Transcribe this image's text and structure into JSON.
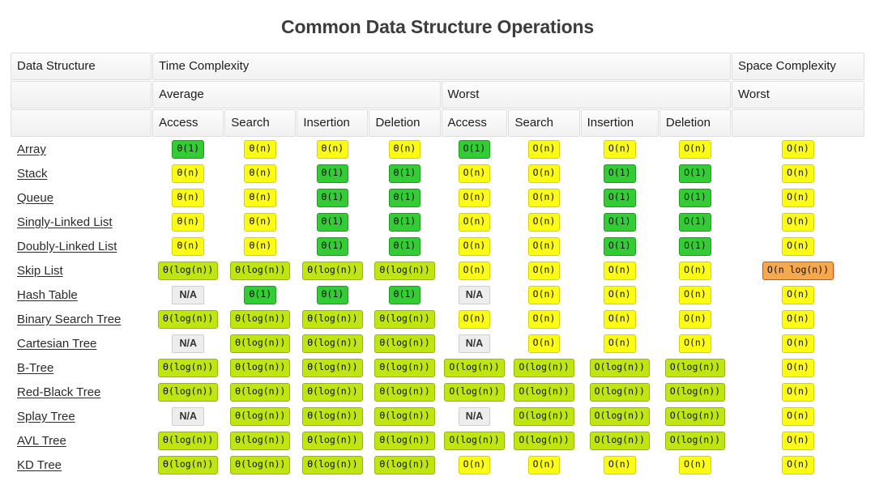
{
  "title": "Common Data Structure Operations",
  "header": {
    "row1": [
      {
        "label": "Data Structure",
        "span": 1
      },
      {
        "label": "Time Complexity",
        "span": 8
      },
      {
        "label": "Space Complexity",
        "span": 1
      }
    ],
    "row2": [
      {
        "label": "",
        "span": 1
      },
      {
        "label": "Average",
        "span": 4
      },
      {
        "label": "Worst",
        "span": 4
      },
      {
        "label": "Worst",
        "span": 1
      }
    ],
    "row3": [
      {
        "label": "",
        "span": 1
      },
      {
        "label": "Access",
        "span": 1
      },
      {
        "label": "Search",
        "span": 1
      },
      {
        "label": "Insertion",
        "span": 1
      },
      {
        "label": "Deletion",
        "span": 1
      },
      {
        "label": "Access",
        "span": 1
      },
      {
        "label": "Search",
        "span": 1
      },
      {
        "label": "Insertion",
        "span": 1
      },
      {
        "label": "Deletion",
        "span": 1
      },
      {
        "label": "",
        "span": 1
      }
    ]
  },
  "colors": {
    "green": "#34cc34",
    "yellow": "#fbfb15",
    "yellowgreen": "#bfe512",
    "orange": "#f5a84d",
    "na": "#ededed",
    "title": "#3c3c3c"
  },
  "chart_data": {
    "type": "table",
    "title": "Common Data Structure Operations",
    "columns": [
      "Data Structure",
      "Average Access",
      "Average Search",
      "Average Insertion",
      "Average Deletion",
      "Worst Access",
      "Worst Search",
      "Worst Insertion",
      "Worst Deletion",
      "Space Worst"
    ],
    "rows": [
      {
        "name": "Array",
        "cells": [
          {
            "text": "Θ(1)",
            "color": "green"
          },
          {
            "text": "Θ(n)",
            "color": "yellow"
          },
          {
            "text": "Θ(n)",
            "color": "yellow"
          },
          {
            "text": "Θ(n)",
            "color": "yellow"
          },
          {
            "text": "O(1)",
            "color": "green"
          },
          {
            "text": "O(n)",
            "color": "yellow"
          },
          {
            "text": "O(n)",
            "color": "yellow"
          },
          {
            "text": "O(n)",
            "color": "yellow"
          },
          {
            "text": "O(n)",
            "color": "yellow"
          }
        ]
      },
      {
        "name": "Stack",
        "cells": [
          {
            "text": "Θ(n)",
            "color": "yellow"
          },
          {
            "text": "Θ(n)",
            "color": "yellow"
          },
          {
            "text": "Θ(1)",
            "color": "green"
          },
          {
            "text": "Θ(1)",
            "color": "green"
          },
          {
            "text": "O(n)",
            "color": "yellow"
          },
          {
            "text": "O(n)",
            "color": "yellow"
          },
          {
            "text": "O(1)",
            "color": "green"
          },
          {
            "text": "O(1)",
            "color": "green"
          },
          {
            "text": "O(n)",
            "color": "yellow"
          }
        ]
      },
      {
        "name": "Queue",
        "cells": [
          {
            "text": "Θ(n)",
            "color": "yellow"
          },
          {
            "text": "Θ(n)",
            "color": "yellow"
          },
          {
            "text": "Θ(1)",
            "color": "green"
          },
          {
            "text": "Θ(1)",
            "color": "green"
          },
          {
            "text": "O(n)",
            "color": "yellow"
          },
          {
            "text": "O(n)",
            "color": "yellow"
          },
          {
            "text": "O(1)",
            "color": "green"
          },
          {
            "text": "O(1)",
            "color": "green"
          },
          {
            "text": "O(n)",
            "color": "yellow"
          }
        ]
      },
      {
        "name": "Singly-Linked List",
        "cells": [
          {
            "text": "Θ(n)",
            "color": "yellow"
          },
          {
            "text": "Θ(n)",
            "color": "yellow"
          },
          {
            "text": "Θ(1)",
            "color": "green"
          },
          {
            "text": "Θ(1)",
            "color": "green"
          },
          {
            "text": "O(n)",
            "color": "yellow"
          },
          {
            "text": "O(n)",
            "color": "yellow"
          },
          {
            "text": "O(1)",
            "color": "green"
          },
          {
            "text": "O(1)",
            "color": "green"
          },
          {
            "text": "O(n)",
            "color": "yellow"
          }
        ]
      },
      {
        "name": "Doubly-Linked List",
        "cells": [
          {
            "text": "Θ(n)",
            "color": "yellow"
          },
          {
            "text": "Θ(n)",
            "color": "yellow"
          },
          {
            "text": "Θ(1)",
            "color": "green"
          },
          {
            "text": "Θ(1)",
            "color": "green"
          },
          {
            "text": "O(n)",
            "color": "yellow"
          },
          {
            "text": "O(n)",
            "color": "yellow"
          },
          {
            "text": "O(1)",
            "color": "green"
          },
          {
            "text": "O(1)",
            "color": "green"
          },
          {
            "text": "O(n)",
            "color": "yellow"
          }
        ]
      },
      {
        "name": "Skip List",
        "cells": [
          {
            "text": "Θ(log(n))",
            "color": "yellowgreen"
          },
          {
            "text": "Θ(log(n))",
            "color": "yellowgreen"
          },
          {
            "text": "Θ(log(n))",
            "color": "yellowgreen"
          },
          {
            "text": "Θ(log(n))",
            "color": "yellowgreen"
          },
          {
            "text": "O(n)",
            "color": "yellow"
          },
          {
            "text": "O(n)",
            "color": "yellow"
          },
          {
            "text": "O(n)",
            "color": "yellow"
          },
          {
            "text": "O(n)",
            "color": "yellow"
          },
          {
            "text": "O(n log(n))",
            "color": "orange"
          }
        ]
      },
      {
        "name": "Hash Table",
        "cells": [
          {
            "text": "N/A",
            "color": "na"
          },
          {
            "text": "Θ(1)",
            "color": "green"
          },
          {
            "text": "Θ(1)",
            "color": "green"
          },
          {
            "text": "Θ(1)",
            "color": "green"
          },
          {
            "text": "N/A",
            "color": "na"
          },
          {
            "text": "O(n)",
            "color": "yellow"
          },
          {
            "text": "O(n)",
            "color": "yellow"
          },
          {
            "text": "O(n)",
            "color": "yellow"
          },
          {
            "text": "O(n)",
            "color": "yellow"
          }
        ]
      },
      {
        "name": "Binary Search Tree",
        "cells": [
          {
            "text": "Θ(log(n))",
            "color": "yellowgreen"
          },
          {
            "text": "Θ(log(n))",
            "color": "yellowgreen"
          },
          {
            "text": "Θ(log(n))",
            "color": "yellowgreen"
          },
          {
            "text": "Θ(log(n))",
            "color": "yellowgreen"
          },
          {
            "text": "O(n)",
            "color": "yellow"
          },
          {
            "text": "O(n)",
            "color": "yellow"
          },
          {
            "text": "O(n)",
            "color": "yellow"
          },
          {
            "text": "O(n)",
            "color": "yellow"
          },
          {
            "text": "O(n)",
            "color": "yellow"
          }
        ]
      },
      {
        "name": "Cartesian Tree",
        "cells": [
          {
            "text": "N/A",
            "color": "na"
          },
          {
            "text": "Θ(log(n))",
            "color": "yellowgreen"
          },
          {
            "text": "Θ(log(n))",
            "color": "yellowgreen"
          },
          {
            "text": "Θ(log(n))",
            "color": "yellowgreen"
          },
          {
            "text": "N/A",
            "color": "na"
          },
          {
            "text": "O(n)",
            "color": "yellow"
          },
          {
            "text": "O(n)",
            "color": "yellow"
          },
          {
            "text": "O(n)",
            "color": "yellow"
          },
          {
            "text": "O(n)",
            "color": "yellow"
          }
        ]
      },
      {
        "name": "B-Tree",
        "cells": [
          {
            "text": "Θ(log(n))",
            "color": "yellowgreen"
          },
          {
            "text": "Θ(log(n))",
            "color": "yellowgreen"
          },
          {
            "text": "Θ(log(n))",
            "color": "yellowgreen"
          },
          {
            "text": "Θ(log(n))",
            "color": "yellowgreen"
          },
          {
            "text": "O(log(n))",
            "color": "yellowgreen"
          },
          {
            "text": "O(log(n))",
            "color": "yellowgreen"
          },
          {
            "text": "O(log(n))",
            "color": "yellowgreen"
          },
          {
            "text": "O(log(n))",
            "color": "yellowgreen"
          },
          {
            "text": "O(n)",
            "color": "yellow"
          }
        ]
      },
      {
        "name": "Red-Black Tree",
        "cells": [
          {
            "text": "Θ(log(n))",
            "color": "yellowgreen"
          },
          {
            "text": "Θ(log(n))",
            "color": "yellowgreen"
          },
          {
            "text": "Θ(log(n))",
            "color": "yellowgreen"
          },
          {
            "text": "Θ(log(n))",
            "color": "yellowgreen"
          },
          {
            "text": "O(log(n))",
            "color": "yellowgreen"
          },
          {
            "text": "O(log(n))",
            "color": "yellowgreen"
          },
          {
            "text": "O(log(n))",
            "color": "yellowgreen"
          },
          {
            "text": "O(log(n))",
            "color": "yellowgreen"
          },
          {
            "text": "O(n)",
            "color": "yellow"
          }
        ]
      },
      {
        "name": "Splay Tree",
        "cells": [
          {
            "text": "N/A",
            "color": "na"
          },
          {
            "text": "Θ(log(n))",
            "color": "yellowgreen"
          },
          {
            "text": "Θ(log(n))",
            "color": "yellowgreen"
          },
          {
            "text": "Θ(log(n))",
            "color": "yellowgreen"
          },
          {
            "text": "N/A",
            "color": "na"
          },
          {
            "text": "O(log(n))",
            "color": "yellowgreen"
          },
          {
            "text": "O(log(n))",
            "color": "yellowgreen"
          },
          {
            "text": "O(log(n))",
            "color": "yellowgreen"
          },
          {
            "text": "O(n)",
            "color": "yellow"
          }
        ]
      },
      {
        "name": "AVL Tree",
        "cells": [
          {
            "text": "Θ(log(n))",
            "color": "yellowgreen"
          },
          {
            "text": "Θ(log(n))",
            "color": "yellowgreen"
          },
          {
            "text": "Θ(log(n))",
            "color": "yellowgreen"
          },
          {
            "text": "Θ(log(n))",
            "color": "yellowgreen"
          },
          {
            "text": "O(log(n))",
            "color": "yellowgreen"
          },
          {
            "text": "O(log(n))",
            "color": "yellowgreen"
          },
          {
            "text": "O(log(n))",
            "color": "yellowgreen"
          },
          {
            "text": "O(log(n))",
            "color": "yellowgreen"
          },
          {
            "text": "O(n)",
            "color": "yellow"
          }
        ]
      },
      {
        "name": "KD Tree",
        "cells": [
          {
            "text": "Θ(log(n))",
            "color": "yellowgreen"
          },
          {
            "text": "Θ(log(n))",
            "color": "yellowgreen"
          },
          {
            "text": "Θ(log(n))",
            "color": "yellowgreen"
          },
          {
            "text": "Θ(log(n))",
            "color": "yellowgreen"
          },
          {
            "text": "O(n)",
            "color": "yellow"
          },
          {
            "text": "O(n)",
            "color": "yellow"
          },
          {
            "text": "O(n)",
            "color": "yellow"
          },
          {
            "text": "O(n)",
            "color": "yellow"
          },
          {
            "text": "O(n)",
            "color": "yellow"
          }
        ]
      }
    ]
  }
}
